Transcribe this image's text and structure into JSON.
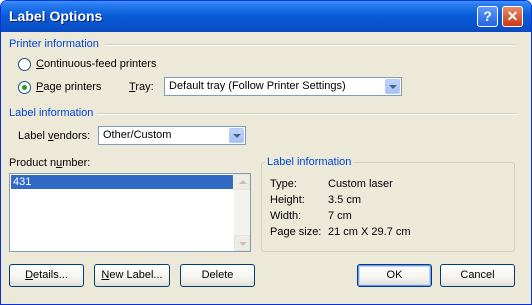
{
  "window": {
    "title": "Label Options",
    "help_glyph": "?",
    "close_glyph": "✕"
  },
  "printer_info": {
    "section_title": "Printer information",
    "continuous_feed": {
      "prefix": "",
      "accel": "C",
      "suffix": "ontinuous-feed printers",
      "checked": false
    },
    "page_printers": {
      "prefix": "",
      "accel": "P",
      "suffix": "age printers",
      "checked": true
    },
    "tray": {
      "prefix": "",
      "accel": "T",
      "suffix": "ray:",
      "value": "Default tray (Follow Printer Settings)"
    }
  },
  "label_info": {
    "section_title": "Label information",
    "vendors": {
      "prefix": "Label ",
      "accel": "v",
      "suffix": "endors:",
      "value": "Other/Custom"
    },
    "product_number": {
      "prefix": "Product n",
      "accel": "u",
      "suffix": "mber:",
      "items": [
        "431"
      ],
      "selected": "431"
    }
  },
  "details_group": {
    "title": "Label information",
    "rows": [
      {
        "key": "Type:",
        "value": "Custom laser"
      },
      {
        "key": "Height:",
        "value": "3.5 cm"
      },
      {
        "key": "Width:",
        "value": "7 cm"
      },
      {
        "key": "Page size:",
        "value": "21 cm X 29.7 cm"
      }
    ]
  },
  "buttons": {
    "details": {
      "accel": "D",
      "rest": "etails..."
    },
    "new_label": {
      "accel": "N",
      "rest": "ew Label..."
    },
    "delete": "Delete",
    "ok": "OK",
    "cancel": "Cancel"
  },
  "colors": {
    "accent": "#0046d5",
    "titlebar": "#0853cb",
    "selection": "#316ac5",
    "dialog_bg": "#ece9d8"
  }
}
